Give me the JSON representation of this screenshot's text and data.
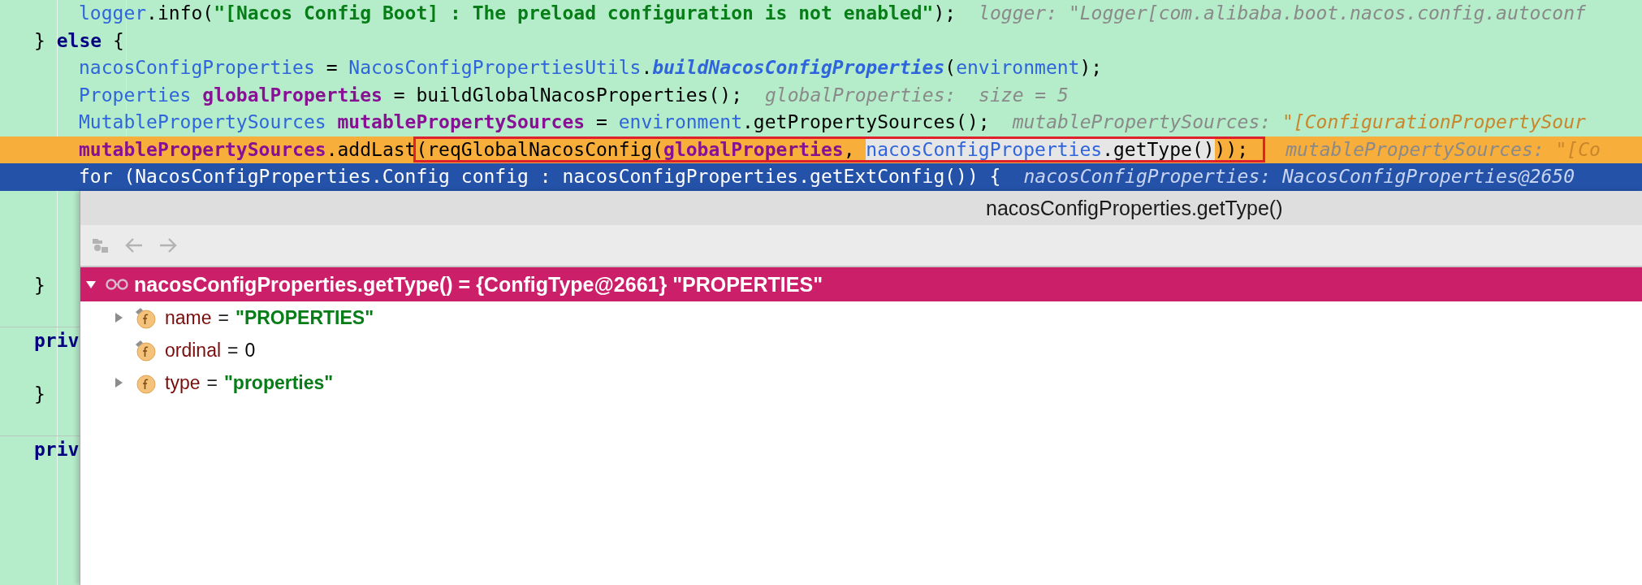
{
  "editor": {
    "lines": [
      {
        "execution_point": false,
        "selected": false,
        "method_separator": false,
        "indented": true,
        "tokens": [
          {
            "text": "logger",
            "kind": "var"
          },
          {
            "text": ".info(",
            "kind": "plain"
          },
          {
            "text": "\"[Nacos Config Boot] : The preload configuration is not enabled\"",
            "kind": "string"
          },
          {
            "text": ");",
            "kind": "plain"
          }
        ],
        "hint": [
          {
            "text": "logger: \"Logger[com.alibaba.boot.nacos.config.autoconf",
            "kind": "hint"
          }
        ]
      },
      {
        "execution_point": false,
        "selected": false,
        "method_separator": false,
        "indented": false,
        "tokens": [
          {
            "text": "} ",
            "kind": "plain"
          },
          {
            "text": "else",
            "kind": "keyword"
          },
          {
            "text": " {",
            "kind": "plain"
          }
        ]
      },
      {
        "execution_point": false,
        "selected": false,
        "method_separator": false,
        "indented": true,
        "tokens": [
          {
            "text": "nacosConfigProperties",
            "kind": "var"
          },
          {
            "text": " = ",
            "kind": "plain"
          },
          {
            "text": "NacosConfigPropertiesUtils",
            "kind": "var"
          },
          {
            "text": ".",
            "kind": "plain"
          },
          {
            "text": "buildNacosConfigProperties",
            "kind": "static"
          },
          {
            "text": "(",
            "kind": "plain"
          },
          {
            "text": "environment",
            "kind": "var"
          },
          {
            "text": ");",
            "kind": "plain"
          }
        ]
      },
      {
        "execution_point": false,
        "selected": false,
        "method_separator": false,
        "indented": true,
        "tokens": [
          {
            "text": "Properties ",
            "kind": "var"
          },
          {
            "text": "globalProperties",
            "kind": "field"
          },
          {
            "text": " = buildGlobalNacosProperties();",
            "kind": "plain"
          }
        ],
        "hint": [
          {
            "text": "globalProperties:  size = 5",
            "kind": "hint"
          }
        ]
      },
      {
        "execution_point": false,
        "selected": false,
        "method_separator": false,
        "indented": true,
        "tokens": [
          {
            "text": "MutablePropertySources ",
            "kind": "var"
          },
          {
            "text": "mutablePropertySources",
            "kind": "field"
          },
          {
            "text": " = ",
            "kind": "plain"
          },
          {
            "text": "environment",
            "kind": "var"
          },
          {
            "text": ".getPropertySources();",
            "kind": "plain"
          }
        ],
        "hint": [
          {
            "text": "mutablePropertySources: ",
            "kind": "hint"
          },
          {
            "text": "\"[ConfigurationPropertySour",
            "kind": "hint_string"
          }
        ]
      },
      {
        "execution_point": true,
        "selected": false,
        "method_separator": false,
        "indented": true,
        "tokens": [
          {
            "text": "mutablePropertySources",
            "kind": "field",
            "boxed": false,
            "marked": false
          },
          {
            "text": ".addLast",
            "kind": "plain",
            "boxed": false,
            "marked": false
          },
          {
            "text": "(reqGlobalNacosConfig(",
            "kind": "plain",
            "boxed": true,
            "marked": false
          },
          {
            "text": "globalProperties",
            "kind": "field",
            "boxed": true,
            "marked": false
          },
          {
            "text": ", ",
            "kind": "plain",
            "boxed": true,
            "marked": false
          },
          {
            "text": "nacosConfigProperties",
            "kind": "var",
            "boxed": true,
            "marked": true
          },
          {
            "text": ".getType()",
            "kind": "plain",
            "boxed": true,
            "marked": true
          },
          {
            "text": "));",
            "kind": "plain",
            "boxed": true,
            "marked": false
          }
        ],
        "hint": [
          {
            "text": "mutablePropertySources: ",
            "kind": "hint"
          },
          {
            "text": "\"[Co",
            "kind": "hint_string"
          }
        ]
      },
      {
        "execution_point": false,
        "selected": true,
        "method_separator": false,
        "indented": true,
        "tokens": [
          {
            "text": "for (NacosConfigProperties.Config config : nacosConfigProperties.getExtConfig()) {",
            "kind": "plain"
          }
        ],
        "hint": [
          {
            "text": "nacosConfigProperties: NacosConfigProperties@2650",
            "kind": "hint"
          }
        ]
      },
      {
        "execution_point": false,
        "selected": false,
        "method_separator": false
      },
      {
        "execution_point": false,
        "selected": false,
        "method_separator": false
      },
      {
        "execution_point": false,
        "selected": false,
        "method_separator": false
      },
      {
        "execution_point": false,
        "selected": false,
        "method_separator": false,
        "indented": false,
        "tokens": [
          {
            "text": "}",
            "kind": "plain"
          }
        ]
      },
      {
        "execution_point": false,
        "selected": false,
        "method_separator": false
      },
      {
        "execution_point": false,
        "selected": false,
        "method_separator": true,
        "indented": false,
        "tokens": [
          {
            "text": "priv",
            "kind": "keyword"
          }
        ]
      },
      {
        "execution_point": false,
        "selected": false,
        "method_separator": false
      },
      {
        "execution_point": false,
        "selected": false,
        "method_separator": false,
        "indented": false,
        "tokens": [
          {
            "text": "}",
            "kind": "plain"
          }
        ]
      },
      {
        "execution_point": false,
        "selected": false,
        "method_separator": false
      },
      {
        "execution_point": false,
        "selected": false,
        "method_separator": true,
        "indented": false,
        "tokens": [
          {
            "text": "priv",
            "kind": "keyword"
          }
        ]
      }
    ]
  },
  "popup": {
    "title": "nacosConfigProperties.getType()",
    "toolbar": [
      {
        "kind": "watch",
        "disabled": true
      },
      {
        "kind": "back",
        "disabled": true
      },
      {
        "kind": "forward",
        "disabled": true
      }
    ],
    "root": {
      "text": "nacosConfigProperties.getType() = {ConfigType@2661} \"PROPERTIES\"",
      "expanded": true,
      "selected": true,
      "children": [
        {
          "kind": "string",
          "name": "name",
          "operator": "=",
          "value": "\"PROPERTIES\"",
          "expandable": true,
          "expanded": false,
          "final": true
        },
        {
          "kind": "number",
          "name": "ordinal",
          "operator": "=",
          "value": "0",
          "expandable": false,
          "final": true
        },
        {
          "kind": "string",
          "name": "type",
          "operator": "=",
          "value": "\"properties\"",
          "expandable": true,
          "expanded": false,
          "final": false
        }
      ]
    }
  }
}
